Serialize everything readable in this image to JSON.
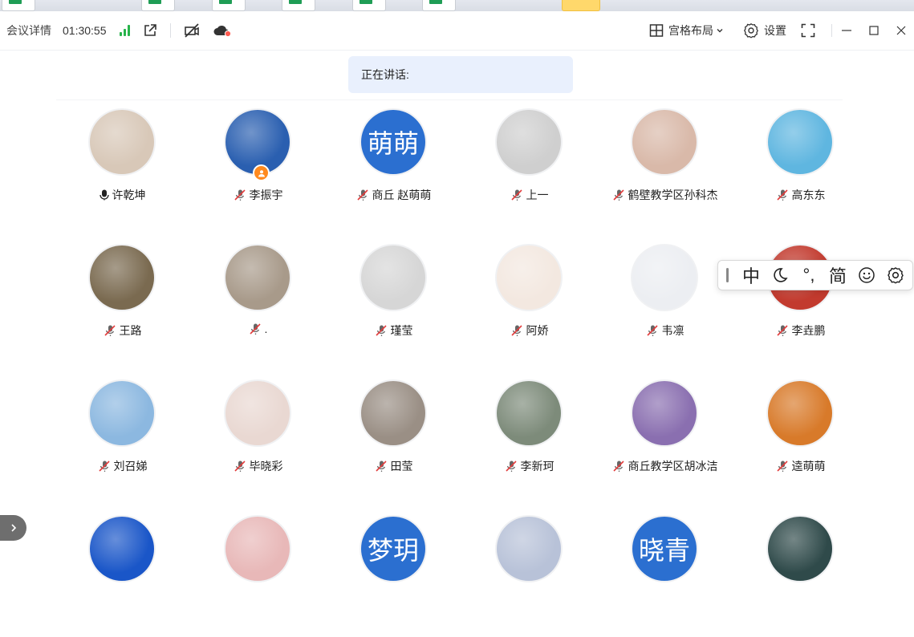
{
  "toolbar": {
    "meeting_details": "会议详情",
    "timer": "01:30:55",
    "layout_label": "宫格布局",
    "settings_label": "设置",
    "accent_color": "#27b34a"
  },
  "speaking": {
    "label": "正在讲话:"
  },
  "participants": [
    {
      "name": "许乾坤",
      "mic": "on",
      "avatar_text": "",
      "color": "#d8c8b8"
    },
    {
      "name": "李振宇",
      "mic": "muted",
      "avatar_text": "",
      "color": "#2a5fb0",
      "badge": "host-icon"
    },
    {
      "name": "商丘 赵萌萌",
      "mic": "muted",
      "avatar_text": "萌萌",
      "color": "#2b6fd0"
    },
    {
      "name": "上一",
      "mic": "muted",
      "avatar_text": "",
      "color": "#cfcfcf"
    },
    {
      "name": "鹤壁教学区孙科杰",
      "mic": "muted",
      "avatar_text": "",
      "color": "#d9b9a9"
    },
    {
      "name": "高东东",
      "mic": "muted",
      "avatar_text": "",
      "color": "#5fb6e0"
    },
    {
      "name": "王路",
      "mic": "muted",
      "avatar_text": "",
      "color": "#7a6a50"
    },
    {
      "name": ".",
      "mic": "muted",
      "avatar_text": "",
      "color": "#a89a8a"
    },
    {
      "name": "瑾莹",
      "mic": "muted",
      "avatar_text": "",
      "color": "#d6d6d6"
    },
    {
      "name": "阿娇",
      "mic": "muted",
      "avatar_text": "",
      "color": "#f3e8e0"
    },
    {
      "name": "韦凛",
      "mic": "muted",
      "avatar_text": "",
      "color": "#eceef2"
    },
    {
      "name": "李垚鹏",
      "mic": "muted",
      "avatar_text": "",
      "color": "#c23a2e"
    },
    {
      "name": "刘召娣",
      "mic": "muted",
      "avatar_text": "",
      "color": "#8cb8e0"
    },
    {
      "name": "毕晓彩",
      "mic": "muted",
      "avatar_text": "",
      "color": "#e9d8d2"
    },
    {
      "name": "田莹",
      "mic": "muted",
      "avatar_text": "",
      "color": "#9a8f85"
    },
    {
      "name": "李新珂",
      "mic": "muted",
      "avatar_text": "",
      "color": "#7d8b7a"
    },
    {
      "name": "商丘教学区胡冰洁",
      "mic": "muted",
      "avatar_text": "",
      "color": "#8a6fb0"
    },
    {
      "name": "逵萌萌",
      "mic": "muted",
      "avatar_text": "",
      "color": "#d87a2a"
    },
    {
      "name": "",
      "mic": "none",
      "avatar_text": "",
      "color": "#1a56c8"
    },
    {
      "name": "",
      "mic": "none",
      "avatar_text": "",
      "color": "#e8b8b8"
    },
    {
      "name": "",
      "mic": "none",
      "avatar_text": "梦玥",
      "color": "#2b6fd0"
    },
    {
      "name": "",
      "mic": "none",
      "avatar_text": "",
      "color": "#b8c2d8"
    },
    {
      "name": "",
      "mic": "none",
      "avatar_text": "晓青",
      "color": "#2b6fd0"
    },
    {
      "name": "",
      "mic": "none",
      "avatar_text": "",
      "color": "#2f4a4a"
    }
  ],
  "ime": {
    "items": [
      "中",
      "moon-icon",
      "°,",
      "简",
      "smiley-icon",
      "gear-icon"
    ]
  }
}
